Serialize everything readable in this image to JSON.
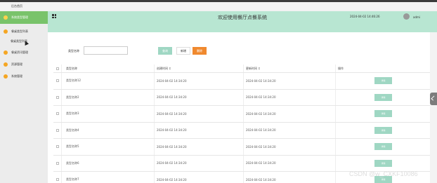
{
  "top": {
    "home": "后台首页"
  },
  "sidebar": {
    "items": [
      {
        "label": "系统类型管理",
        "active": true
      },
      {
        "label": "餐桌类型列表",
        "active": false
      }
    ],
    "sub": [
      {
        "label": "餐桌类型列表"
      }
    ],
    "more": [
      {
        "label": "餐桌资讯管理"
      },
      {
        "label": "资源管理"
      },
      {
        "label": "系统管理"
      }
    ]
  },
  "header": {
    "title": "欢迎使用餐厅点餐系统",
    "time": "2024-04-02 14:46:26",
    "user": "admi"
  },
  "filter": {
    "label": "类型名称",
    "placeholder": "",
    "search": "查询",
    "add": "新增",
    "delete": "删除"
  },
  "table": {
    "headers": [
      "类型名称",
      "创建时间 ↕",
      "更新时间 ↕",
      "操作"
    ],
    "rows": [
      {
        "name": "类型名称12",
        "created": "2024-04-02 14:34:20",
        "updated": "2024-04-02 14:34:20",
        "action": "详情"
      },
      {
        "name": "类型名称2",
        "created": "2024-04-02 14:34:20",
        "updated": "2024-04-02 14:34:20",
        "action": "详情"
      },
      {
        "name": "类型名称3",
        "created": "2024-04-02 14:34:20",
        "updated": "2024-04-02 14:34:20",
        "action": "详情"
      },
      {
        "name": "类型名称4",
        "created": "2024-04-02 14:34:20",
        "updated": "2024-04-02 14:34:20",
        "action": "详情"
      },
      {
        "name": "类型名称5",
        "created": "2024-04-02 14:34:20",
        "updated": "2024-04-02 14:34:20",
        "action": "详情"
      },
      {
        "name": "类型名称6",
        "created": "2024-04-02 14:34:20",
        "updated": "2024-04-02 14:34:20",
        "action": "详情"
      },
      {
        "name": "类型名称7",
        "created": "2024-04-02 14:34:20",
        "updated": "2024-04-02 14:34:20",
        "action": "详情"
      }
    ]
  },
  "watermark": "CSDN @w_CXKF10086",
  "colors": {
    "accent": "#79c36a",
    "header": "#b8e6d2",
    "danger": "#f0892e",
    "button": "#9fd7c3"
  }
}
